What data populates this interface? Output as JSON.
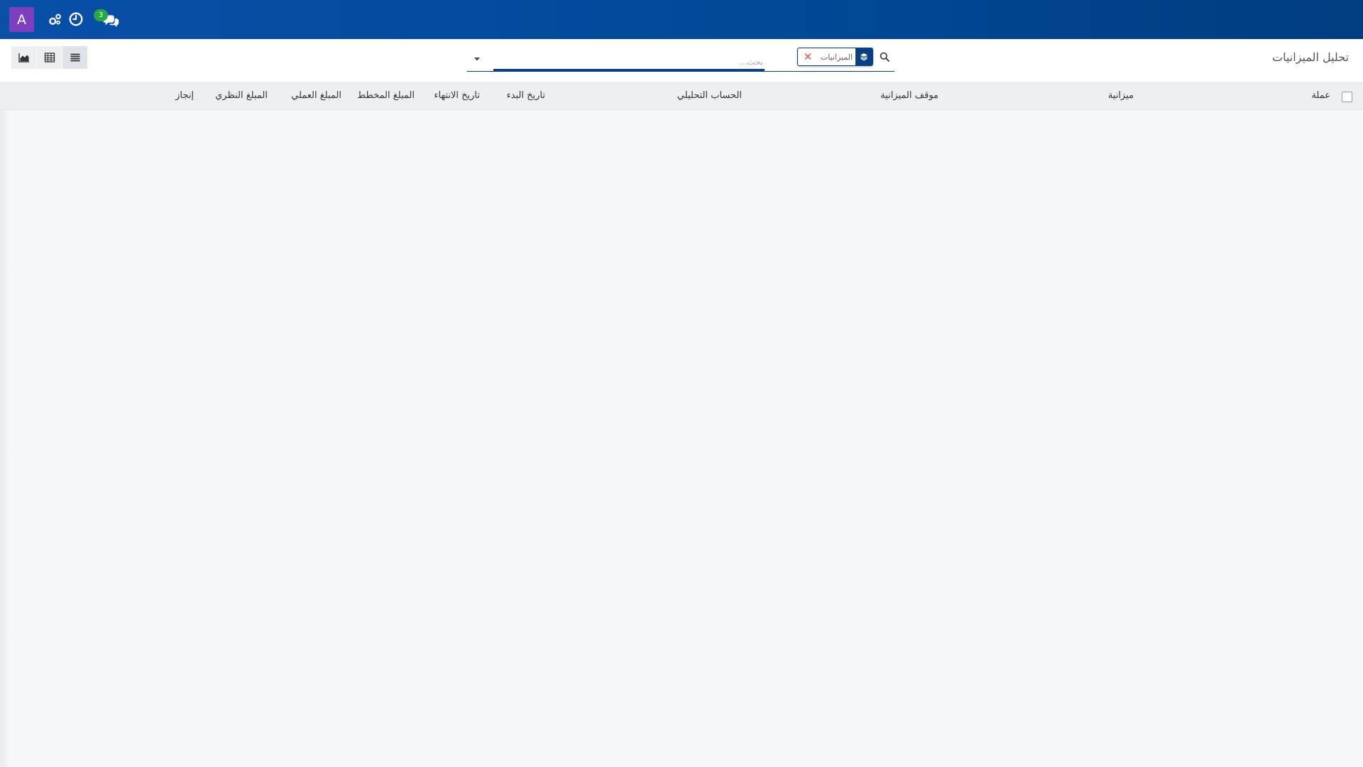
{
  "navbar": {
    "avatar_letter": "A",
    "icons": [
      "gear-icon",
      "clock-icon",
      "chat-icon"
    ],
    "chat_badge": "3",
    "colors": {
      "bar": "#004a98",
      "avatar": "#7b3fbf",
      "badge": "#27a844"
    }
  },
  "control_panel": {
    "title": "تحليل الميزانيات",
    "search": {
      "placeholder": "بحث...",
      "value": "",
      "facet": {
        "value": "الميزانيات",
        "icon": "layers-icon"
      }
    },
    "views": [
      "graph-icon",
      "pivot-icon",
      "list-icon"
    ],
    "active_view": "list-icon"
  },
  "list": {
    "columns": {
      "currency": "عملة",
      "budget": "ميزانية",
      "budget_position": "موقف الميزانية",
      "analytic_account": "الحساب التحليلي",
      "start_date": "تاريخ البدء",
      "end_date": "تاريخ الانتهاء",
      "planned_amount": "المبلغ المخطط",
      "practical_amount": "المبلغ العملي",
      "theoretical_amount": "المبلغ النظري",
      "achievement": "إنجاز"
    },
    "rows": []
  }
}
